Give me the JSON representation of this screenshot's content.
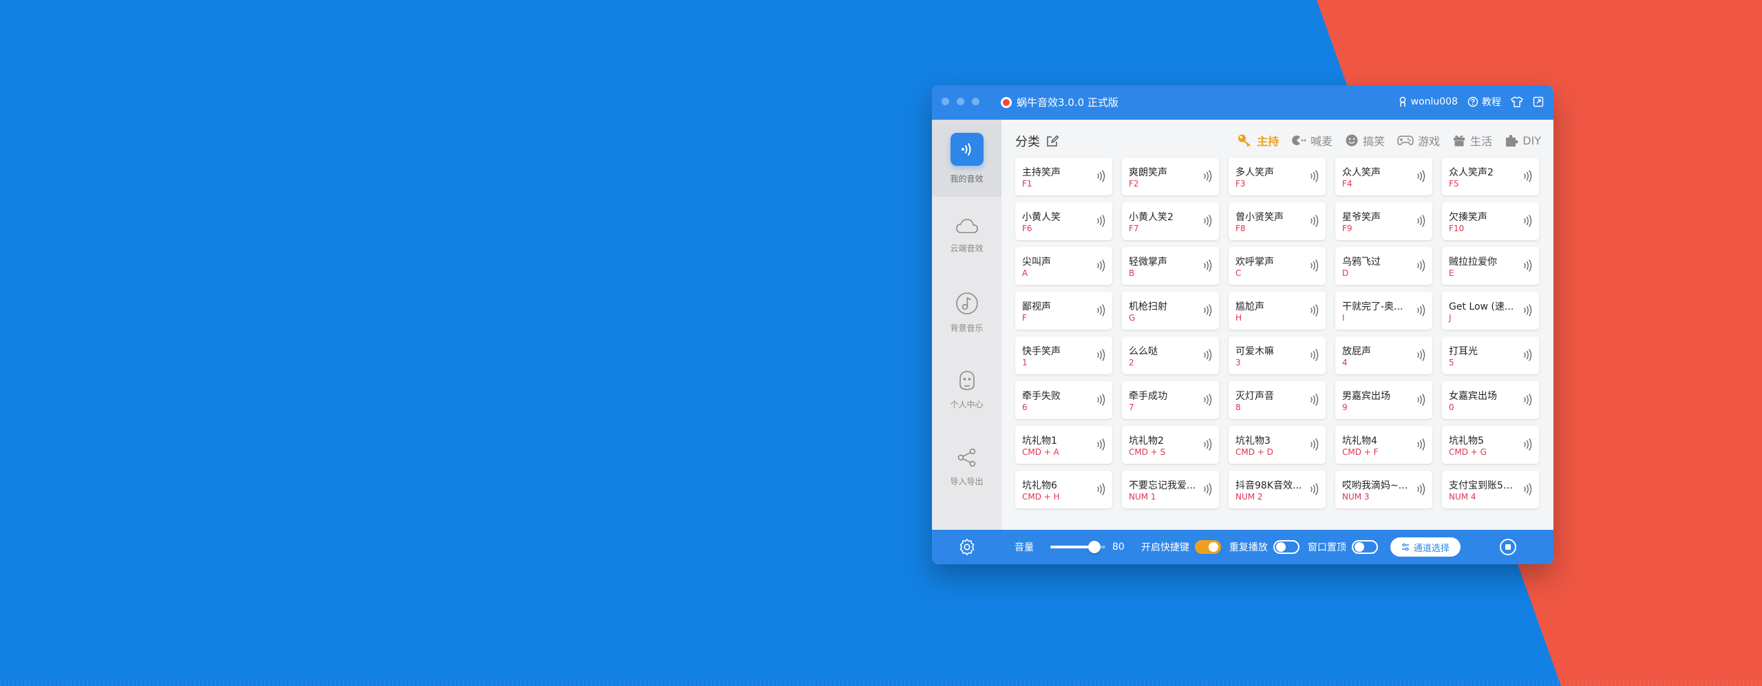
{
  "window": {
    "title": "蜗牛音效3.0.0 正式版",
    "username": "wonlu008",
    "tutorial_label": "教程"
  },
  "sidebar": {
    "items": [
      {
        "label": "我的音效",
        "icon": "sound-wave-icon",
        "active": true
      },
      {
        "label": "云端音效",
        "icon": "cloud-icon"
      },
      {
        "label": "背景音乐",
        "icon": "music-note-icon"
      },
      {
        "label": "个人中心",
        "icon": "robot-avatar-icon"
      },
      {
        "label": "导入导出",
        "icon": "share-icon"
      }
    ]
  },
  "category": {
    "title": "分类",
    "tabs": [
      {
        "label": "主持",
        "icon": "key-icon",
        "active": true
      },
      {
        "label": "喊麦",
        "icon": "pacman-icon"
      },
      {
        "label": "搞笑",
        "icon": "smile-icon"
      },
      {
        "label": "游戏",
        "icon": "gamepad-icon"
      },
      {
        "label": "生活",
        "icon": "gift-icon"
      },
      {
        "label": "DIY",
        "icon": "puzzle-icon"
      }
    ]
  },
  "sounds": [
    {
      "name": "主持笑声",
      "key": "F1"
    },
    {
      "name": "爽朗笑声",
      "key": "F2"
    },
    {
      "name": "多人笑声",
      "key": "F3"
    },
    {
      "name": "众人笑声",
      "key": "F4"
    },
    {
      "name": "众人笑声2",
      "key": "F5"
    },
    {
      "name": "小黄人笑",
      "key": "F6"
    },
    {
      "name": "小黄人笑2",
      "key": "F7"
    },
    {
      "name": "曾小贤笑声",
      "key": "F8"
    },
    {
      "name": "星爷笑声",
      "key": "F9"
    },
    {
      "name": "欠揍笑声",
      "key": "F10"
    },
    {
      "name": "尖叫声",
      "key": "A"
    },
    {
      "name": "轻微掌声",
      "key": "B"
    },
    {
      "name": "欢呼掌声",
      "key": "C"
    },
    {
      "name": "乌鸦飞过",
      "key": "D"
    },
    {
      "name": "贼拉拉爱你",
      "key": "E"
    },
    {
      "name": "鄙视声",
      "key": "F"
    },
    {
      "name": "机枪扫射",
      "key": "G"
    },
    {
      "name": "尴尬声",
      "key": "H"
    },
    {
      "name": "干就完了-奥...",
      "key": "I"
    },
    {
      "name": "Get Low (速...",
      "key": "J"
    },
    {
      "name": "快手笑声",
      "key": "1"
    },
    {
      "name": "么么哒",
      "key": "2"
    },
    {
      "name": "可爱木嘛",
      "key": "3"
    },
    {
      "name": "放屁声",
      "key": "4"
    },
    {
      "name": "打耳光",
      "key": "5"
    },
    {
      "name": "牵手失败",
      "key": "6"
    },
    {
      "name": "牵手成功",
      "key": "7"
    },
    {
      "name": "灭灯声音",
      "key": "8"
    },
    {
      "name": "男嘉宾出场",
      "key": "9"
    },
    {
      "name": "女嘉宾出场",
      "key": "0"
    },
    {
      "name": "坑礼物1",
      "key": "CMD + A"
    },
    {
      "name": "坑礼物2",
      "key": "CMD + S"
    },
    {
      "name": "坑礼物3",
      "key": "CMD + D"
    },
    {
      "name": "坑礼物4",
      "key": "CMD + F"
    },
    {
      "name": "坑礼物5",
      "key": "CMD + G"
    },
    {
      "name": "坑礼物6",
      "key": "CMD + H"
    },
    {
      "name": "不要忘记我爱...",
      "key": "NUM 1"
    },
    {
      "name": "抖音98K音效...",
      "key": "NUM 2"
    },
    {
      "name": "哎哟我滴妈~...",
      "key": "NUM 3"
    },
    {
      "name": "支付宝到账50...",
      "key": "NUM 4"
    }
  ],
  "bottom": {
    "volume_label": "音量",
    "volume_value": "80",
    "volume_fraction": 0.8,
    "hotkey_label": "开启快捷键",
    "hotkey_on": true,
    "repeat_label": "重复播放",
    "repeat_on": false,
    "pin_label": "窗口置顶",
    "pin_on": false,
    "channel_label": "通道选择"
  },
  "colors": {
    "background_blue": "#1380e3",
    "background_red": "#ef5744",
    "accent_blue": "#2e86e8",
    "active_orange": "#f0a020",
    "key_red": "#e0334f"
  }
}
